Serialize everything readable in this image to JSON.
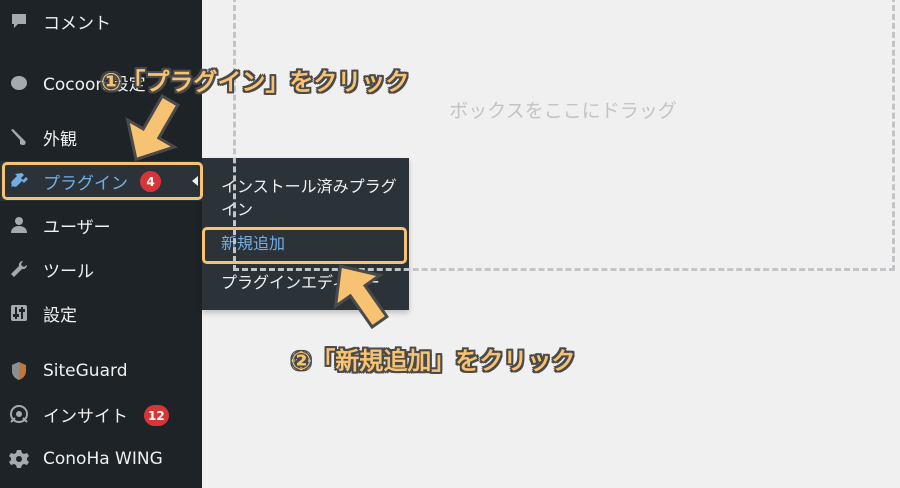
{
  "sidebar": {
    "items": [
      {
        "label": "コメント",
        "icon": "comment-icon"
      },
      {
        "label": "Cocoon 設定",
        "icon": "cocoon-icon"
      },
      {
        "label": "外観",
        "icon": "paintbrush-icon"
      },
      {
        "label": "プラグイン",
        "icon": "plugin-icon",
        "badge": "4",
        "active": true
      },
      {
        "label": "ユーザー",
        "icon": "user-icon"
      },
      {
        "label": "ツール",
        "icon": "wrench-icon"
      },
      {
        "label": "設定",
        "icon": "settings-icon"
      },
      {
        "label": "SiteGuard",
        "icon": "siteguard-icon"
      },
      {
        "label": "インサイト",
        "icon": "insight-icon",
        "badge": "12"
      },
      {
        "label": "ConoHa WING",
        "icon": "gear-icon"
      }
    ]
  },
  "submenu": {
    "items": [
      {
        "label": "インストール済みプラグイン"
      },
      {
        "label": "新規追加",
        "highlighted": true
      },
      {
        "label": "プラグインエディター"
      }
    ]
  },
  "dropzone": {
    "text": "ボックスをここにドラッグ"
  },
  "annotations": {
    "step1": "①「プラグイン」をクリック",
    "step2": "②「新規追加」をクリック"
  },
  "colors": {
    "sidebar_bg": "#1d2327",
    "submenu_bg": "#2c3338",
    "active_text": "#72aee6",
    "badge": "#d63638",
    "highlight": "#f7c271",
    "canvas": "#f0f0f1"
  }
}
